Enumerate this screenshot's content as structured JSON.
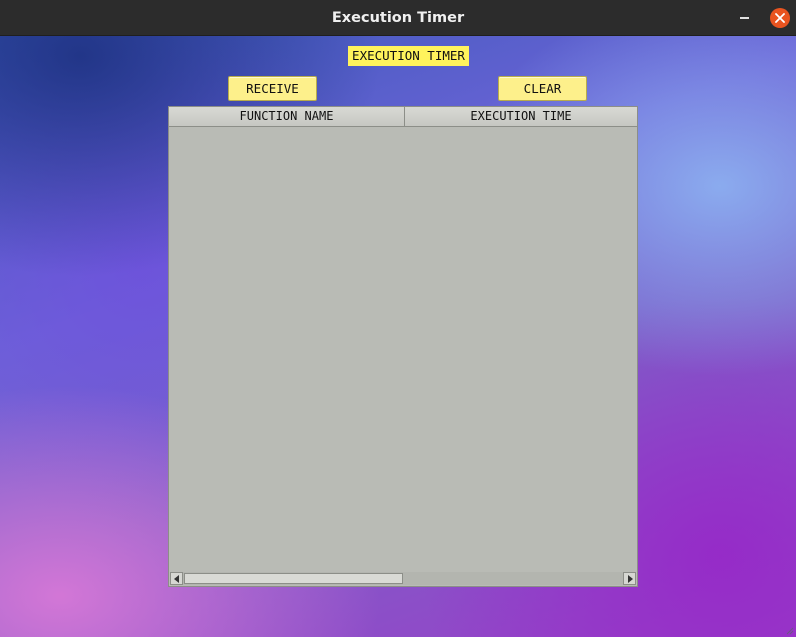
{
  "window": {
    "title": "Execution Timer"
  },
  "app": {
    "heading": "EXECUTION TIMER",
    "buttons": {
      "receive_label": "RECEIVE",
      "clear_label": "CLEAR"
    },
    "table": {
      "columns": [
        "FUNCTION NAME",
        "EXECUTION TIME"
      ],
      "rows": []
    }
  },
  "colors": {
    "button_background": "#fdf08b",
    "heading_background": "#fff35c",
    "table_background": "#b9bbb5",
    "close_button": "#e95420"
  },
  "icons": {
    "close": "close-icon",
    "minimize": "minimize-icon",
    "scroll_left": "arrow-left-icon",
    "scroll_right": "arrow-right-icon"
  }
}
